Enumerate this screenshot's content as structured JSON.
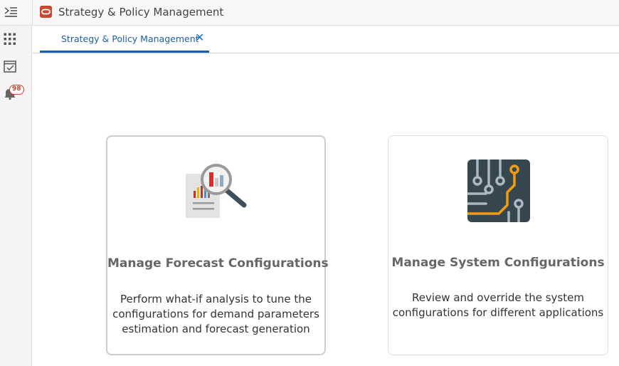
{
  "header": {
    "app_title": "Strategy & Policy Management",
    "menu_icon": "menu-collapse-icon",
    "logo_icon": "oracle-logo-icon"
  },
  "sidenav": {
    "items": [
      {
        "name": "apps-grid-icon"
      },
      {
        "name": "tasks-calendar-icon"
      },
      {
        "name": "notifications-bell-icon",
        "badge": "98"
      }
    ]
  },
  "tabs": [
    {
      "label": "Strategy & Policy Management",
      "active": true,
      "closable": true
    }
  ],
  "cards": [
    {
      "title": "Manage Forecast Configurations",
      "desc_lines": [
        "Perform what-if analysis to tune the",
        "configurations for demand parameters",
        "estimation and forecast generation"
      ],
      "icon": "report-magnifier-icon"
    },
    {
      "title": "Manage System Configurations",
      "desc_lines": [
        "Review and override the system",
        "configurations for different applications"
      ],
      "icon": "circuit-board-icon"
    }
  ],
  "colors": {
    "accent_blue": "#1d5ea8",
    "badge_red": "#c74634",
    "circuit_bg": "#37474f",
    "circuit_orange": "#f39c12"
  }
}
